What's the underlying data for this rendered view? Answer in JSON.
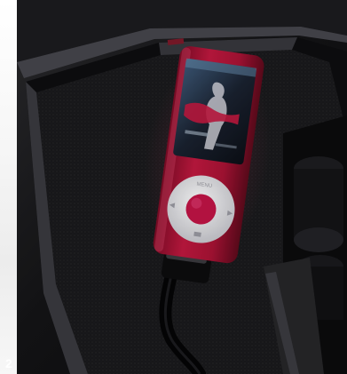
{
  "figure": {
    "number": "2"
  },
  "colors": {
    "device_body": "#b1143a",
    "console_dark": "#0f0f10",
    "tray_edge": "#3c3c40",
    "wheel_center": "#c21446",
    "wheel_ring": "#e7e7ea"
  },
  "icons": {
    "player": "media-player-icon",
    "cable": "cable-icon"
  }
}
